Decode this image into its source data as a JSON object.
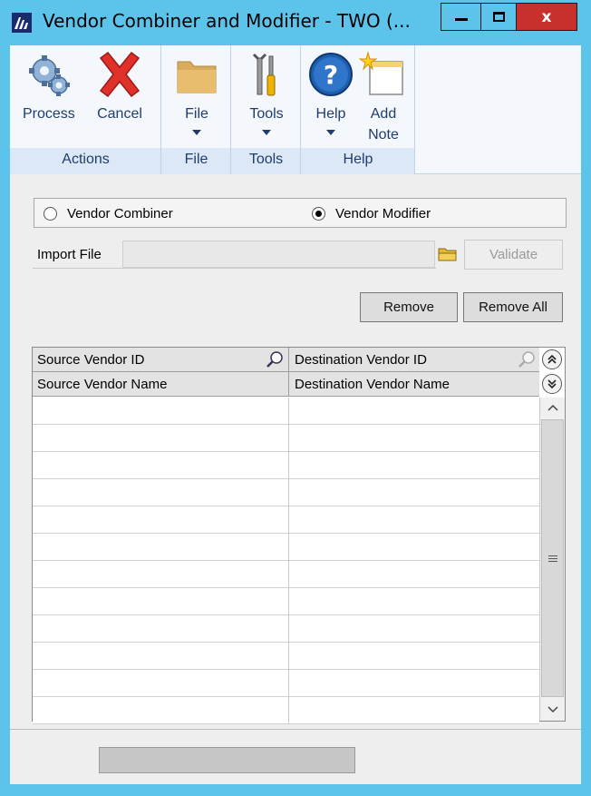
{
  "window": {
    "title": "Vendor Combiner and Modifier  -  TWO (...",
    "minimize_label": "",
    "maximize_label": "",
    "close_label": "x"
  },
  "ribbon": {
    "groups": [
      {
        "label": "Actions",
        "buttons": [
          {
            "label": "Process",
            "icon": "gears-icon"
          },
          {
            "label": "Cancel",
            "icon": "red-x-icon"
          }
        ]
      },
      {
        "label": "File",
        "buttons": [
          {
            "label": "File",
            "icon": "folder-icon"
          }
        ]
      },
      {
        "label": "Tools",
        "buttons": [
          {
            "label": "Tools",
            "icon": "tools-icon"
          }
        ]
      },
      {
        "label": "Help",
        "buttons": [
          {
            "label": "Help",
            "icon": "help-icon"
          },
          {
            "label": "Add\nNote",
            "icon": "add-note-icon"
          }
        ]
      }
    ]
  },
  "mode": {
    "options": [
      {
        "label": "Vendor Combiner",
        "selected": false
      },
      {
        "label": "Vendor Modifier",
        "selected": true
      }
    ]
  },
  "import": {
    "label": "Import File",
    "value": "",
    "validate_label": "Validate"
  },
  "actions": {
    "remove_label": "Remove",
    "remove_all_label": "Remove All"
  },
  "grid": {
    "header_row1": [
      "Source Vendor ID",
      "Destination Vendor ID"
    ],
    "header_row2": [
      "Source Vendor Name",
      "Destination Vendor Name"
    ],
    "row_count": 12
  },
  "colors": {
    "title_bar": "#5cc3ea",
    "close_button": "#c7302c",
    "ribbon_text": "#1e3d6e"
  }
}
